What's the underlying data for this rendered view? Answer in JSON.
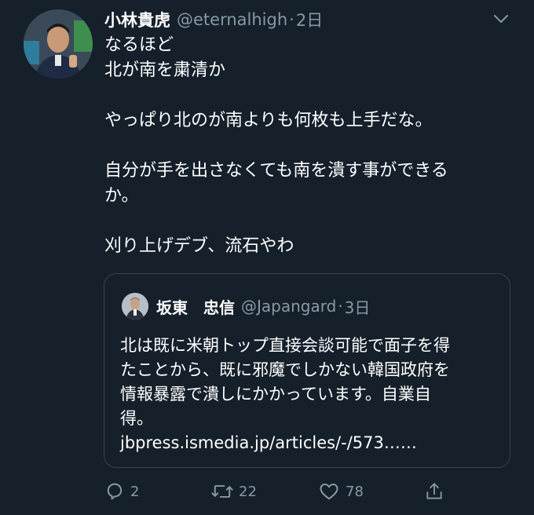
{
  "tweet": {
    "display_name": "小林貴虎",
    "handle": "@eternalhigh",
    "separator": "·",
    "time": "2日",
    "lines": [
      "なるほど",
      "北が南を粛清か",
      "",
      "やっぱり北のが南よりも何枚も上手だな。",
      "",
      "自分が手を出さなくても南を潰す事ができる",
      "か。",
      "",
      "刈り上げデブ、流石やわ"
    ]
  },
  "quoted": {
    "display_name": "坂東　忠信",
    "handle": "@Japangard",
    "separator": "·",
    "time": "3日",
    "lines": [
      "北は既に米朝トップ直接会談可能で面子を得",
      "たことから、既に邪魔でしかない韓国政府を",
      "情報暴露で潰しにかかっています。自業自",
      "得。"
    ],
    "link": "jbpress.ismedia.jp/articles/-/573……"
  },
  "actions": {
    "reply_count": "2",
    "retweet_count": "22",
    "like_count": "78"
  },
  "colors": {
    "background": "#15202b",
    "secondary_text": "#8899a6",
    "border": "#38444d"
  },
  "icons": {
    "reply": "reply-icon",
    "retweet": "retweet-icon",
    "like": "heart-icon",
    "share": "share-icon",
    "menu": "chevron-down-icon"
  }
}
